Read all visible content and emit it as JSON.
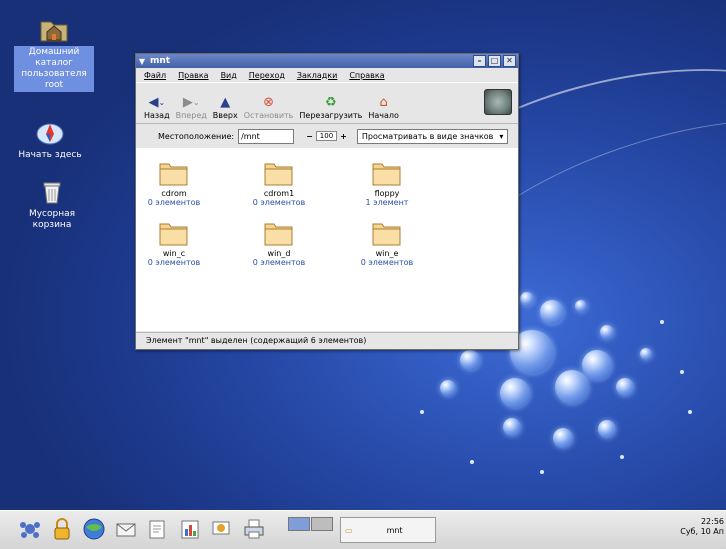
{
  "desktop": {
    "icons": [
      {
        "label": "Домашний каталог пользователя root"
      },
      {
        "label": "Начать здесь"
      },
      {
        "label": "Мусорная корзина"
      }
    ]
  },
  "window": {
    "title": "mnt",
    "menu": [
      "Файл",
      "Правка",
      "Вид",
      "Переход",
      "Закладки",
      "Справка"
    ],
    "toolbar": {
      "back": "Назад",
      "forward": "Вперед",
      "up": "Вверх",
      "stop": "Остановить",
      "reload": "Перезагрузить",
      "home": "Начало"
    },
    "location": {
      "label": "Местоположение:",
      "value": "/mnt",
      "zoom": "100",
      "view": "Просматривать в виде значков"
    },
    "folders": [
      {
        "name": "cdrom",
        "count": "0 элементов"
      },
      {
        "name": "cdrom1",
        "count": "0 элементов"
      },
      {
        "name": "floppy",
        "count": "1 элемент"
      },
      {
        "name": "win_c",
        "count": "0 элементов"
      },
      {
        "name": "win_d",
        "count": "0 элементов"
      },
      {
        "name": "win_e",
        "count": "0 элементов"
      }
    ],
    "status": "Элемент \"mnt\" выделен (содержащий 6 элементов)"
  },
  "panel": {
    "task_label": "mnt",
    "clock_time": "22:56",
    "clock_date": "Суб, 10 Ап"
  }
}
